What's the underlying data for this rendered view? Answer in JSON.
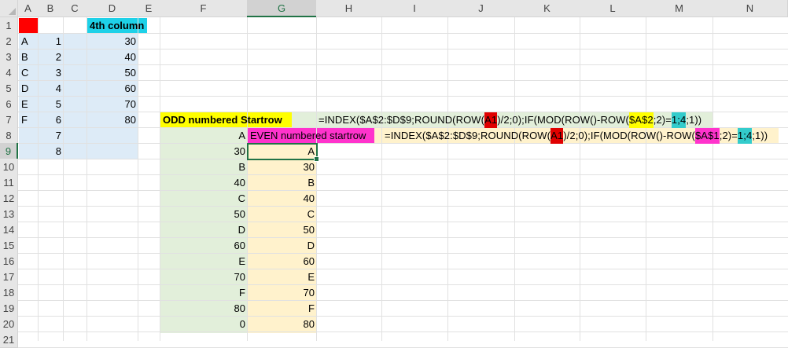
{
  "columns": [
    "A",
    "B",
    "C",
    "D",
    "E",
    "F",
    "G",
    "H",
    "I",
    "J",
    "K",
    "L",
    "M",
    "N"
  ],
  "rows": [
    "1",
    "2",
    "3",
    "4",
    "5",
    "6",
    "7",
    "8",
    "9",
    "10",
    "11",
    "12",
    "13",
    "14",
    "15",
    "16",
    "17",
    "18",
    "19",
    "20",
    "21"
  ],
  "cells": {
    "D1": "4th column",
    "A2": "A",
    "B2": "1",
    "D2": "30",
    "A3": "B",
    "B3": "2",
    "D3": "40",
    "A4": "C",
    "B4": "3",
    "D4": "50",
    "A5": "D",
    "B5": "4",
    "D5": "60",
    "A6": "E",
    "B6": "5",
    "D6": "70",
    "A7": "F",
    "B7": "6",
    "D7": "80",
    "B8": "7",
    "B9": "8",
    "F7": "ODD numbered Startrow",
    "F8": "A",
    "G8": "EVEN numbered startrow",
    "F9": "30",
    "G9": "A",
    "F10": "B",
    "G10": "30",
    "F11": "40",
    "G11": "B",
    "F12": "C",
    "G12": "40",
    "F13": "50",
    "G13": "C",
    "F14": "D",
    "G14": "50",
    "F15": "60",
    "G15": "D",
    "F16": "E",
    "G16": "60",
    "F17": "70",
    "G17": "E",
    "F18": "F",
    "G18": "70",
    "F19": "80",
    "G19": "F",
    "F20": "0",
    "G20": "80"
  },
  "formula_odd_parts": [
    "=INDEX($A$2:$D$9;ROUND(ROW(",
    "A1",
    ")/2;0);IF(MOD(ROW()-ROW(",
    "$A$2",
    ";2)=",
    "1",
    ";",
    "4",
    ";1))"
  ],
  "formula_even_parts": [
    "=INDEX($A$2:$D$9;ROUND(ROW(",
    "A1",
    ")/2;0);IF(MOD(ROW()-ROW(",
    "$A$1",
    ";2)=",
    "1",
    ";",
    "4",
    ";1))"
  ],
  "active_cell": "G9",
  "colors": {
    "red": "#ff0000",
    "cyan_header": "#1ed1e8",
    "light_blue": "#ddebf7",
    "yellow": "#ffff00",
    "magenta": "#ff33cc",
    "light_green": "#e2efda",
    "light_peach": "#fff2cc",
    "dark_red": "#e00000",
    "teal": "#33cccc",
    "excel_green": "#217346"
  }
}
